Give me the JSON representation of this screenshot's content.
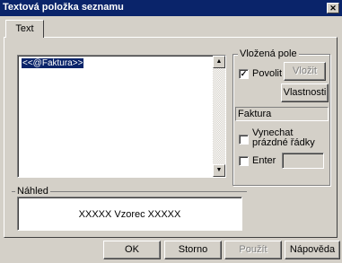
{
  "window": {
    "title": "Textová položka seznamu",
    "close_glyph": "✕"
  },
  "tabs": [
    {
      "label": "Text"
    }
  ],
  "editor": {
    "field_token": "<<@Faktura>>",
    "scroll_up": "▲",
    "scroll_down": "▼"
  },
  "insert_field": {
    "group_label": "Vložená pole",
    "allow_label": "Povolit",
    "allow_checked": "✓",
    "insert_button": "Vložit",
    "properties_button": "Vlastnosti",
    "field_name": "Faktura",
    "skip_empty_label": "Vynechat prázdné řádky",
    "enter_label": "Enter"
  },
  "preview": {
    "group_label": "Náhled",
    "text": "XXXXX Vzorec XXXXX"
  },
  "buttons": {
    "ok": "OK",
    "cancel": "Storno",
    "apply": "Použít",
    "help": "Nápověda"
  }
}
